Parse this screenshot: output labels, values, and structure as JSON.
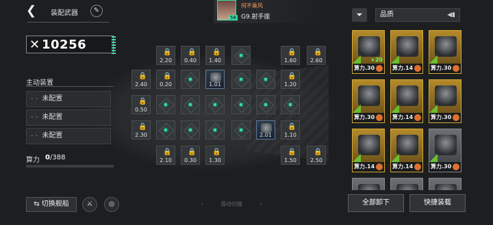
{
  "header": {
    "back_icon": "chevron-left-icon",
    "title": "装配武器",
    "edit_icon": "pencil-icon"
  },
  "player": {
    "name": "何不乘风",
    "level": "58",
    "rank": "G9.射手座"
  },
  "filter": {
    "filter_icon": "filter-icon",
    "quality_label": "品质",
    "sort_icon": "sort-toggle-icon"
  },
  "power": {
    "icon": "crossed-swords-icon",
    "value": "10256"
  },
  "active_equipment": {
    "title": "主动装置",
    "slots": [
      {
        "label": "未配置"
      },
      {
        "label": "未配置"
      },
      {
        "label": "未配置"
      }
    ]
  },
  "compute": {
    "label": "算力",
    "current": "0",
    "max": "/388"
  },
  "grid": {
    "cells": [
      {
        "state": "locked",
        "value": "2.20"
      },
      {
        "state": "locked",
        "value": "0.40"
      },
      {
        "state": "locked",
        "value": "1.40"
      },
      {
        "state": "empty",
        "value": ""
      },
      {
        "state": "locked",
        "value": "1.60"
      },
      {
        "state": "locked",
        "value": "2.60"
      },
      {
        "state": "locked",
        "value": "2.40"
      },
      {
        "state": "locked",
        "value": "0.20"
      },
      {
        "state": "empty",
        "value": ""
      },
      {
        "state": "item",
        "value": "1.01"
      },
      {
        "state": "empty",
        "value": ""
      },
      {
        "state": "empty",
        "value": ""
      },
      {
        "state": "locked",
        "value": "1.20"
      },
      {
        "state": "locked",
        "value": "0.50"
      },
      {
        "state": "empty",
        "value": ""
      },
      {
        "state": "empty",
        "value": ""
      },
      {
        "state": "empty",
        "value": ""
      },
      {
        "state": "empty",
        "value": ""
      },
      {
        "state": "empty",
        "value": ""
      },
      {
        "state": "empty",
        "value": ""
      },
      {
        "state": "locked",
        "value": "2.30"
      },
      {
        "state": "empty",
        "value": ""
      },
      {
        "state": "empty",
        "value": ""
      },
      {
        "state": "empty",
        "value": ""
      },
      {
        "state": "empty",
        "value": ""
      },
      {
        "state": "item",
        "value": "2.01"
      },
      {
        "state": "locked",
        "value": "1.10"
      },
      {
        "state": "locked",
        "value": "2.10"
      },
      {
        "state": "locked",
        "value": "0.30"
      },
      {
        "state": "locked",
        "value": "1.30"
      },
      {
        "state": "locked",
        "value": "1.50"
      },
      {
        "state": "locked",
        "value": "2.50"
      }
    ]
  },
  "bottom": {
    "switch_ship": "⇆ 切换舰船",
    "swipe_hint": "滑动切换",
    "unequip_all": "全部卸下",
    "quick_equip": "快捷装载"
  },
  "inventory": [
    {
      "rarity": "gold",
      "stat": "算力.30",
      "bonus": "+20"
    },
    {
      "rarity": "gold",
      "stat": "算力.14",
      "bonus": ""
    },
    {
      "rarity": "gold",
      "stat": "算力.30",
      "bonus": ""
    },
    {
      "rarity": "gold",
      "stat": "算力.30",
      "bonus": ""
    },
    {
      "rarity": "gold",
      "stat": "算力.14",
      "bonus": ""
    },
    {
      "rarity": "gold",
      "stat": "算力.30",
      "bonus": ""
    },
    {
      "rarity": "gold",
      "stat": "算力.14",
      "bonus": ""
    },
    {
      "rarity": "gold",
      "stat": "算力.14",
      "bonus": ""
    },
    {
      "rarity": "gray",
      "stat": "算力.30",
      "bonus": ""
    },
    {
      "rarity": "gray",
      "stat": "",
      "bonus": ""
    },
    {
      "rarity": "gray",
      "stat": "",
      "bonus": ""
    },
    {
      "rarity": "gray",
      "stat": "",
      "bonus": ""
    }
  ]
}
